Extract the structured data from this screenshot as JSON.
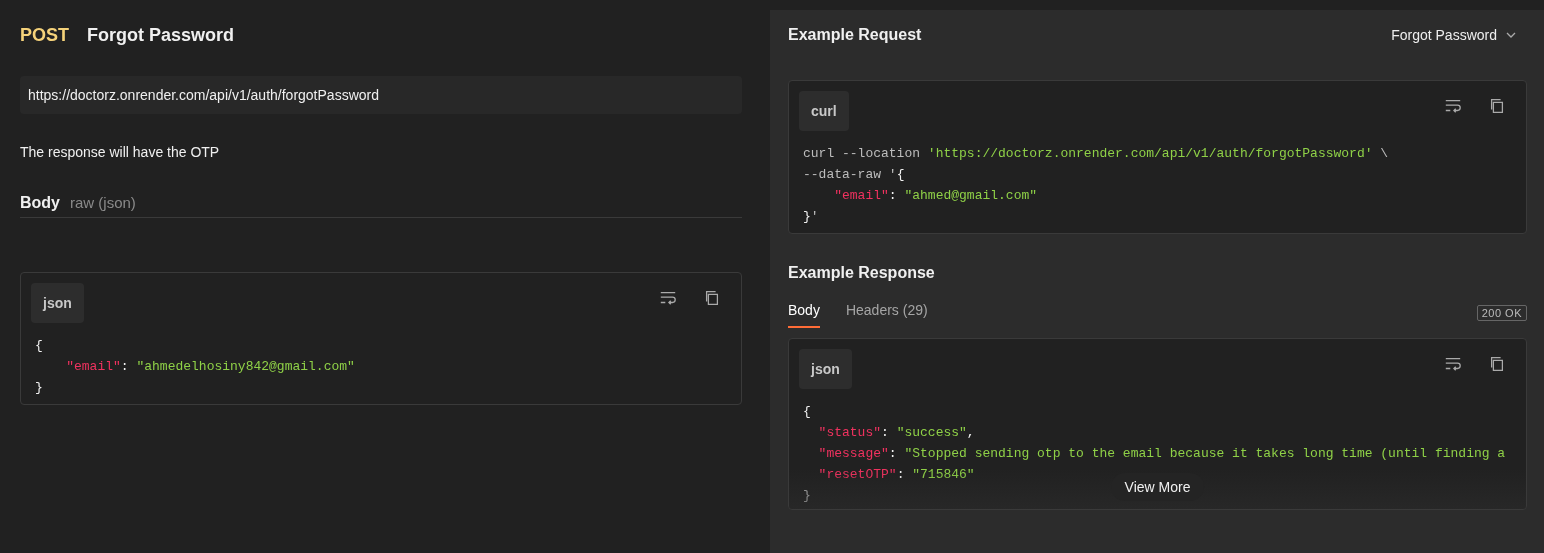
{
  "request": {
    "method": "POST",
    "title": "Forgot Password",
    "url": "https://doctorz.onrender.com/api/v1/auth/forgotPassword",
    "description": "The response will have the OTP",
    "body": {
      "label": "Body",
      "type": "raw (json)",
      "code": {
        "language": "json",
        "lines": [
          [
            {
              "kind": "punct",
              "text": "{"
            }
          ],
          [
            {
              "kind": "key",
              "text": "    \"email\""
            },
            {
              "kind": "punct",
              "text": ": "
            },
            {
              "kind": "str",
              "text": "\"ahmedelhosiny842@gmail.com\""
            }
          ],
          [
            {
              "kind": "punct",
              "text": "}"
            }
          ]
        ]
      }
    }
  },
  "example_request": {
    "title": "Example Request",
    "dropdown": "Forgot Password",
    "code": {
      "language": "curl",
      "lines": [
        [
          {
            "kind": "plain",
            "text": "curl --location "
          },
          {
            "kind": "str",
            "text": "'https://doctorz.onrender.com/api/v1/auth/forgotPassword'"
          },
          {
            "kind": "plain",
            "text": " \\"
          }
        ],
        [
          {
            "kind": "plain",
            "text": "--data-raw '"
          },
          {
            "kind": "punct",
            "text": "{"
          }
        ],
        [
          {
            "kind": "key",
            "text": "    \"email\""
          },
          {
            "kind": "punct",
            "text": ": "
          },
          {
            "kind": "str",
            "text": "\"ahmed@gmail.com\""
          }
        ],
        [
          {
            "kind": "punct",
            "text": "}"
          },
          {
            "kind": "plain",
            "text": "'"
          }
        ]
      ]
    }
  },
  "example_response": {
    "title": "Example Response",
    "tabs": [
      {
        "label": "Body",
        "selected": true
      },
      {
        "label": "Headers (29)",
        "selected": false
      }
    ],
    "status": "200 OK",
    "code": {
      "language": "json",
      "lines": [
        [
          {
            "kind": "punct",
            "text": "{"
          }
        ],
        [
          {
            "kind": "key",
            "text": "  \"status\""
          },
          {
            "kind": "punct",
            "text": ": "
          },
          {
            "kind": "str",
            "text": "\"success\""
          },
          {
            "kind": "punct",
            "text": ","
          }
        ],
        [
          {
            "kind": "key",
            "text": "  \"message\""
          },
          {
            "kind": "punct",
            "text": ": "
          },
          {
            "kind": "str",
            "text": "\"Stopped sending otp to the email because it takes long time (until finding a"
          }
        ],
        [
          {
            "kind": "key",
            "text": "  \"resetOTP\""
          },
          {
            "kind": "punct",
            "text": ": "
          },
          {
            "kind": "str",
            "text": "\"715846\""
          }
        ],
        [
          {
            "kind": "punct",
            "text": "}"
          }
        ]
      ]
    },
    "view_more": "View More"
  }
}
